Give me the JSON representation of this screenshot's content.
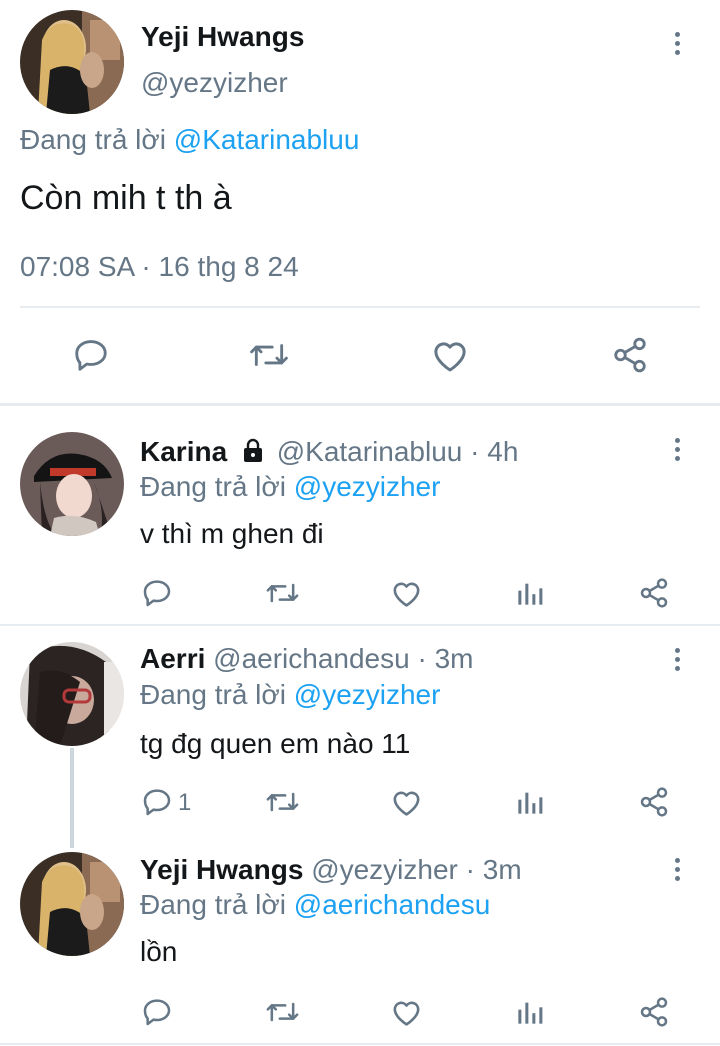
{
  "colors": {
    "accent": "#1da1f2",
    "muted": "#657786",
    "text": "#14171a",
    "divider": "#e6ecf0"
  },
  "main_tweet": {
    "name": "Yeji Hwangs",
    "handle": "@yezyizher",
    "replying_prefix": "Đang trả lời",
    "replying_to": "@Katarinabluu",
    "text": "Còn mih t th à",
    "timestamp": "07:08 SA · 16 thg 8 24",
    "actions": [
      "reply-icon",
      "retweet-icon",
      "like-icon",
      "share-icon"
    ]
  },
  "replies": [
    {
      "name": "Karina",
      "locked": true,
      "handle": "@Katarinabluu",
      "time": "· 4h",
      "replying_prefix": "Đang trả lời",
      "replying_to": "@yezyizher",
      "text": "v thì m ghen đi",
      "reply_count": ""
    },
    {
      "name": "Aerri",
      "locked": false,
      "handle": "@aerichandesu",
      "time": "· 3m",
      "replying_prefix": "Đang trả lời",
      "replying_to": "@yezyizher",
      "text": "tg đg quen em nào 11",
      "reply_count": "1"
    },
    {
      "name": "Yeji Hwangs",
      "locked": false,
      "handle": "@yezyizher",
      "time": "· 3m",
      "replying_prefix": "Đang trả lời",
      "replying_to": "@aerichandesu",
      "text": "lồn",
      "reply_count": ""
    }
  ]
}
